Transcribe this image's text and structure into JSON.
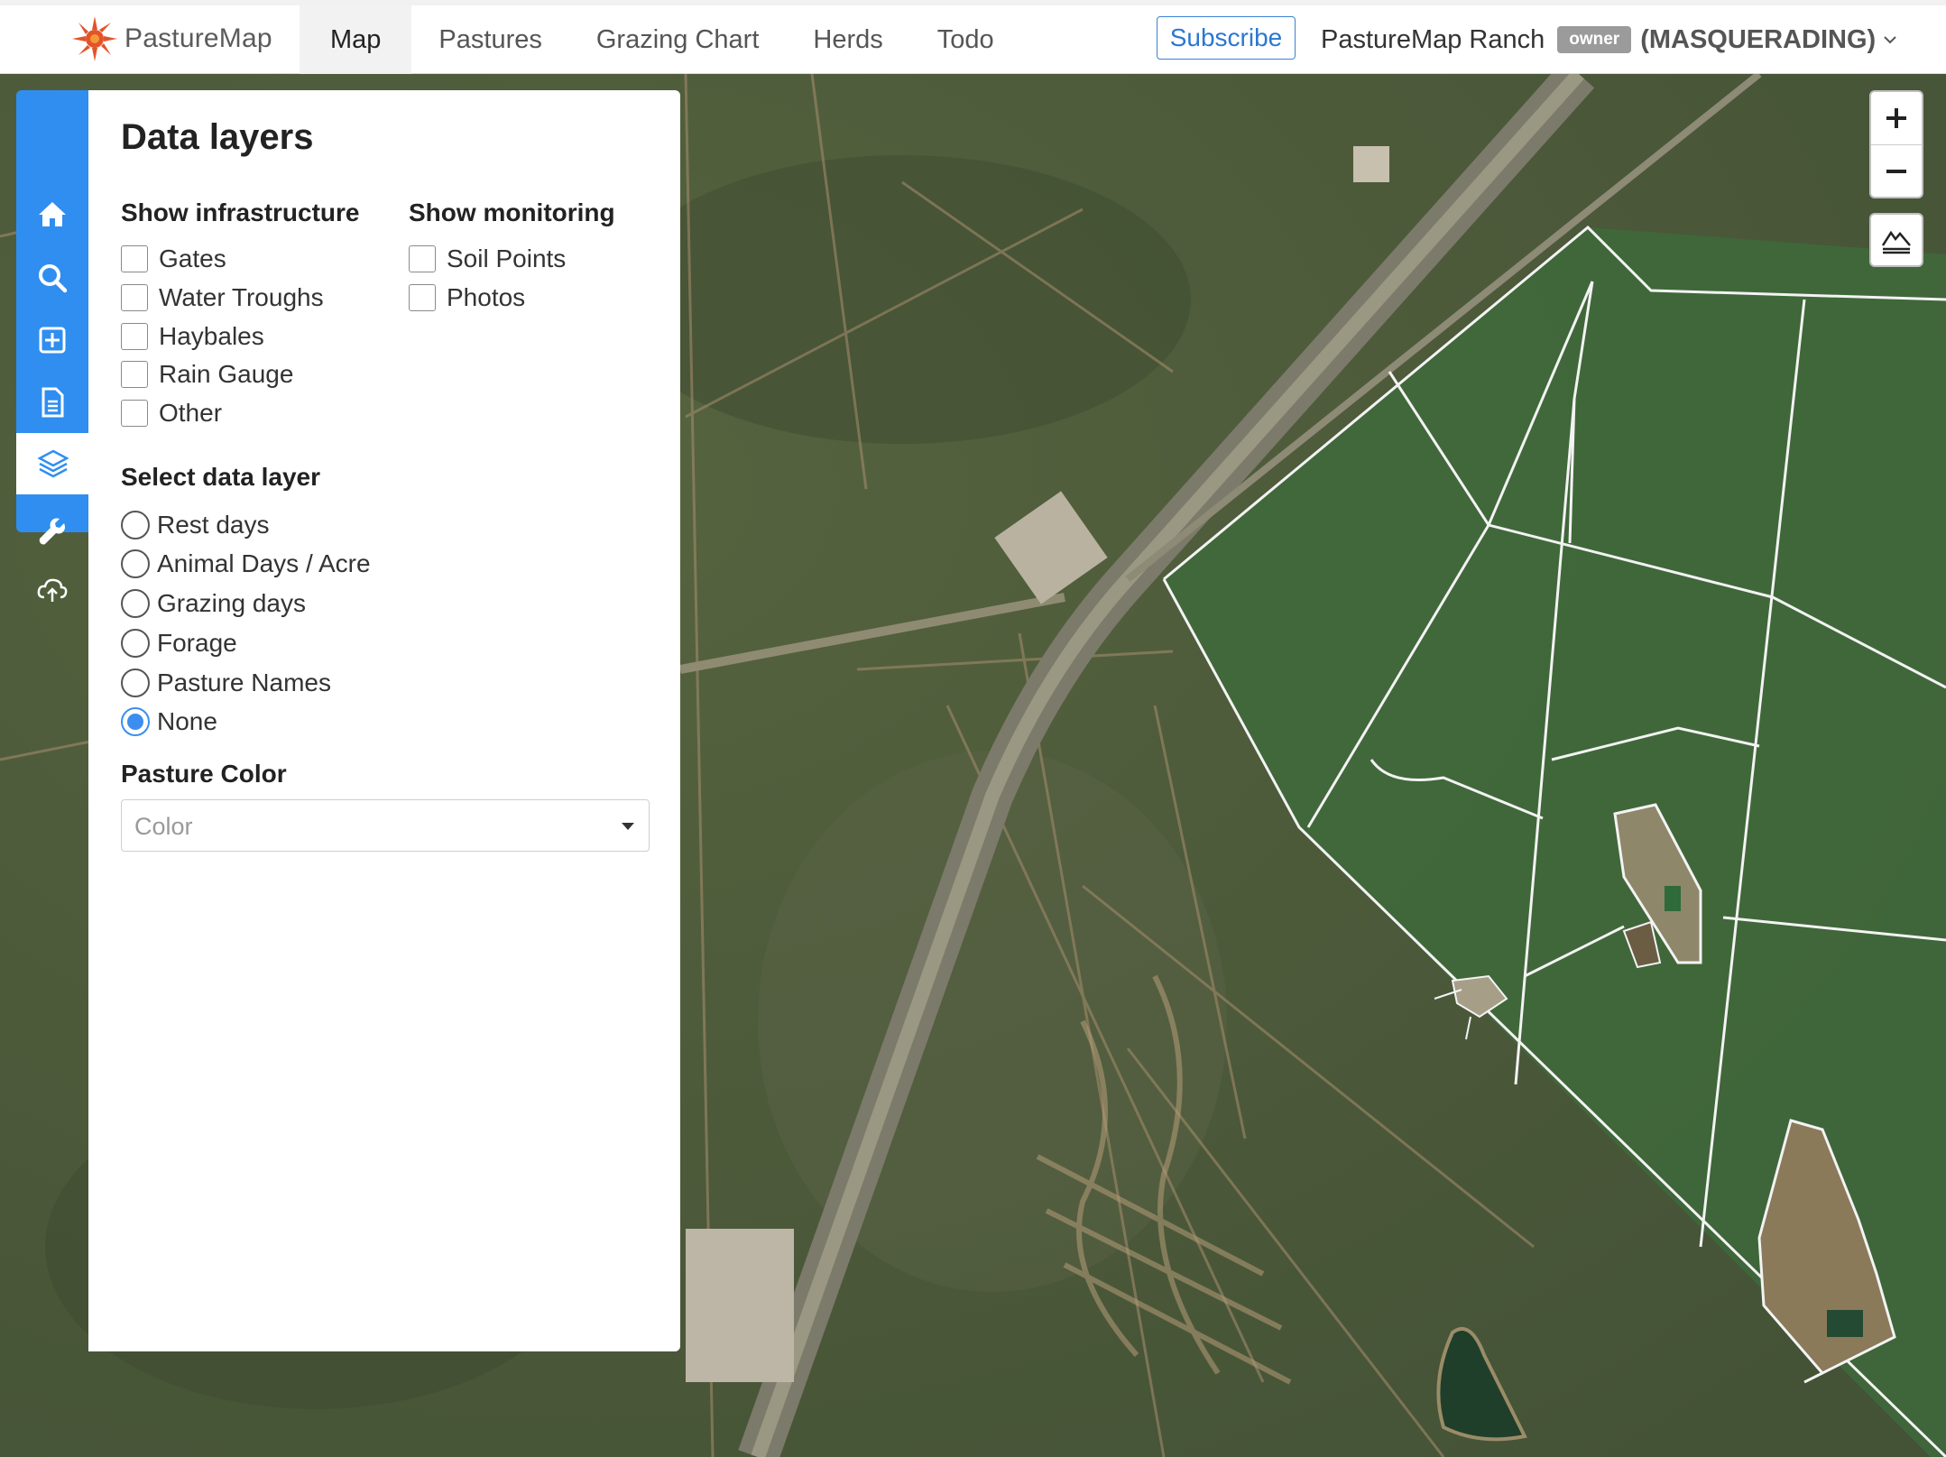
{
  "brand": {
    "name": "PastureMap"
  },
  "nav": {
    "tabs": [
      {
        "label": "Map",
        "active": true
      },
      {
        "label": "Pastures"
      },
      {
        "label": "Grazing Chart"
      },
      {
        "label": "Herds"
      },
      {
        "label": "Todo"
      }
    ],
    "subscribe_label": "Subscribe",
    "ranch_name": "PastureMap Ranch",
    "owner_badge": "owner",
    "masquerading": "(MASQUERADING)"
  },
  "sidebar": {
    "icons": [
      "home-icon",
      "search-icon",
      "add-icon",
      "document-icon",
      "layers-icon",
      "wrench-icon",
      "cloud-upload-icon"
    ],
    "active": "layers-icon"
  },
  "panel": {
    "title": "Data layers",
    "infrastructure": {
      "title": "Show infrastructure",
      "items": [
        "Gates",
        "Water Troughs",
        "Haybales",
        "Rain Gauge",
        "Other"
      ]
    },
    "monitoring": {
      "title": "Show monitoring",
      "items": [
        "Soil Points",
        "Photos"
      ]
    },
    "data_layer": {
      "title": "Select data layer",
      "options": [
        "Rest days",
        "Animal Days / Acre",
        "Grazing days",
        "Forage",
        "Pasture Names",
        "None"
      ],
      "selected": "None"
    },
    "pasture_color": {
      "title": "Pasture Color",
      "placeholder": "Color"
    }
  },
  "map_controls": {
    "zoom_in": "+",
    "zoom_out": "−"
  },
  "colors": {
    "accent": "#2f8ef0",
    "subscribe": "#2a78d1",
    "map_base": "#4f5d3c",
    "pasture_green": "#3f6b3c",
    "boundary": "#f2f2f2"
  }
}
